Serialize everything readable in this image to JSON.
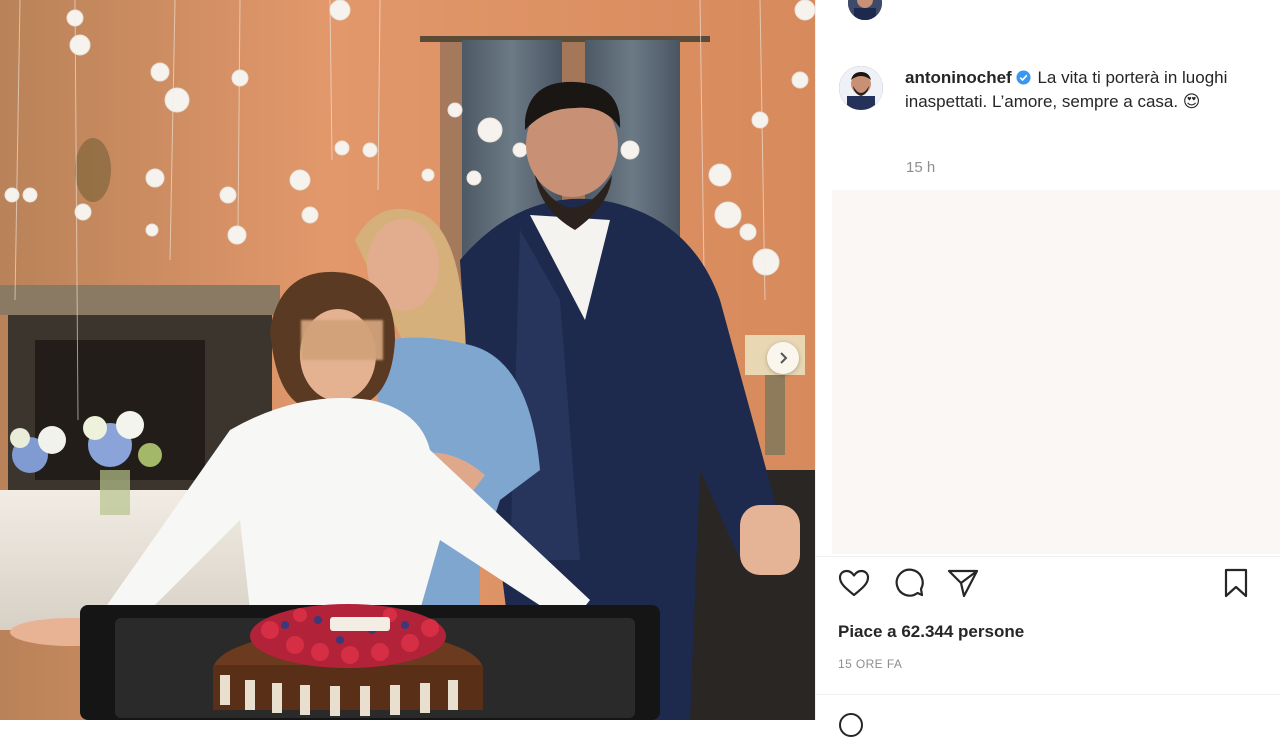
{
  "post": {
    "username": "antoninochef",
    "caption_text": "La vita ti porterà in luoghi inaspettati. L’amore, sempre a casa. 😍",
    "time_short": "15 h",
    "likes_text": "Piace a 62.344 persone",
    "posted_ago": "15 ORE FA"
  },
  "icons": {
    "verified": "verified-badge-icon",
    "like": "heart-icon",
    "comment": "comment-icon",
    "share": "paper-plane-icon",
    "save": "bookmark-icon",
    "next": "chevron-right-icon"
  },
  "colors": {
    "verified_blue": "#3897f0",
    "text_primary": "#262626",
    "text_secondary": "#8e8e8e"
  }
}
